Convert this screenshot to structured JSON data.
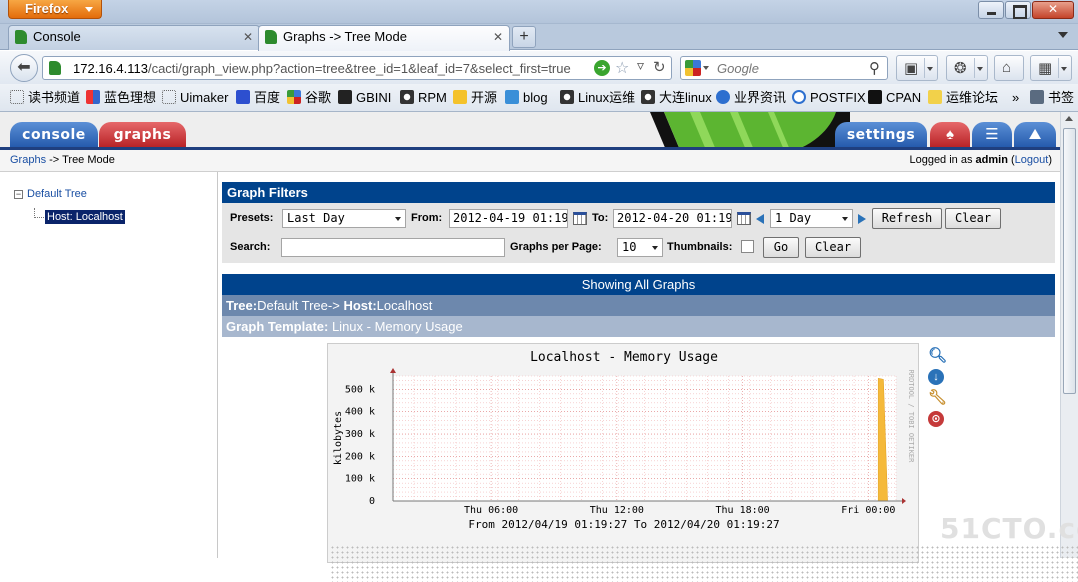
{
  "browser": {
    "app_button": "Firefox",
    "tabs": [
      {
        "label": "Console"
      },
      {
        "label": "Graphs -> Tree Mode"
      }
    ],
    "url_host": "172.16.4.113",
    "url_path": "/cacti/graph_view.php?action=tree&tree_id=1&leaf_id=7&select_first=true",
    "search_placeholder": "Google",
    "bookmarks": [
      "读书频道",
      "蓝色理想",
      "Uimaker",
      "百度",
      "谷歌",
      "GBINI",
      "RPM",
      "开源",
      "blog",
      "Linux运维",
      "大连linux",
      "业界资讯",
      "POSTFIX",
      "CPAN",
      "运维论坛"
    ],
    "bookmarks_overflow": "»",
    "bookmarks_menu": "书签"
  },
  "cacti": {
    "tabs": {
      "console": "console",
      "graphs": "graphs",
      "settings": "settings"
    },
    "breadcrumb": {
      "link": "Graphs",
      "sep": " -> ",
      "current": "Tree Mode"
    },
    "login": {
      "prefix": "Logged in as ",
      "user": "admin",
      "logout": "Logout"
    },
    "tree": {
      "root": "Default Tree",
      "leaf": "Host: Localhost"
    },
    "filters": {
      "title": "Graph Filters",
      "presets_label": "Presets:",
      "presets_value": "Last Day",
      "from_label": "From:",
      "from_value": "2012-04-19 01:19",
      "to_label": "To:",
      "to_value": "2012-04-20 01:19",
      "timespan_value": "1 Day",
      "refresh_label": "Refresh",
      "clear_label": "Clear",
      "search_label": "Search:",
      "search_value": "",
      "per_page_label": "Graphs per Page:",
      "per_page_value": "10",
      "thumbnails_label": "Thumbnails:",
      "go_label": "Go",
      "clear2_label": "Clear"
    },
    "showing": "Showing All Graphs",
    "tree_header": {
      "tree_label": "Tree:",
      "tree_value": "Default Tree-> ",
      "host_label": "Host:",
      "host_value": "Localhost"
    },
    "template_header": {
      "label": "Graph Template:",
      "value": " Linux - Memory Usage"
    }
  },
  "chart_data": {
    "type": "area",
    "title": "Localhost - Memory Usage",
    "ylabel": "kilobytes",
    "y_ticks": [
      "0",
      "100 k",
      "200 k",
      "300 k",
      "400 k",
      "500 k"
    ],
    "ylim": [
      0,
      560000
    ],
    "x_ticks": [
      "Thu 06:00",
      "Thu 12:00",
      "Thu 18:00",
      "Fri 00:00"
    ],
    "x_range_hours": [
      0,
      24
    ],
    "x_tick_hours": [
      4.68,
      10.68,
      16.68,
      22.68
    ],
    "footer": "From 2012/04/19 01:19:27 To 2012/04/20 01:19:27",
    "side_text": "RRDTOOL / TOBI OETIKER",
    "grid": true,
    "series": [
      {
        "color": "#f5b93a",
        "x_hours": [
          23.15,
          23.4,
          23.6
        ],
        "values": [
          550000,
          545000,
          0
        ]
      }
    ]
  }
}
